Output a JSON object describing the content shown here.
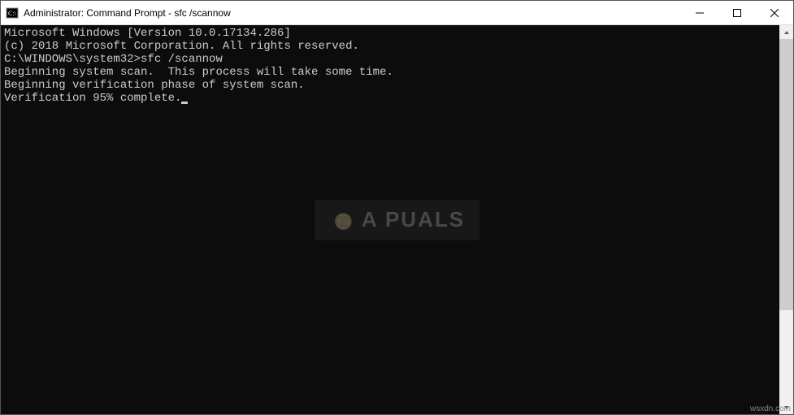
{
  "window": {
    "title": "Administrator: Command Prompt - sfc  /scannow"
  },
  "terminal": {
    "lines": [
      "Microsoft Windows [Version 10.0.17134.286]",
      "(c) 2018 Microsoft Corporation. All rights reserved.",
      "",
      "C:\\WINDOWS\\system32>sfc /scannow",
      "",
      "Beginning system scan.  This process will take some time.",
      "",
      "Beginning verification phase of system scan.",
      "Verification 95% complete."
    ]
  },
  "watermark": {
    "text": "A  PUALS"
  },
  "source": {
    "label": "wsxdn.com"
  }
}
